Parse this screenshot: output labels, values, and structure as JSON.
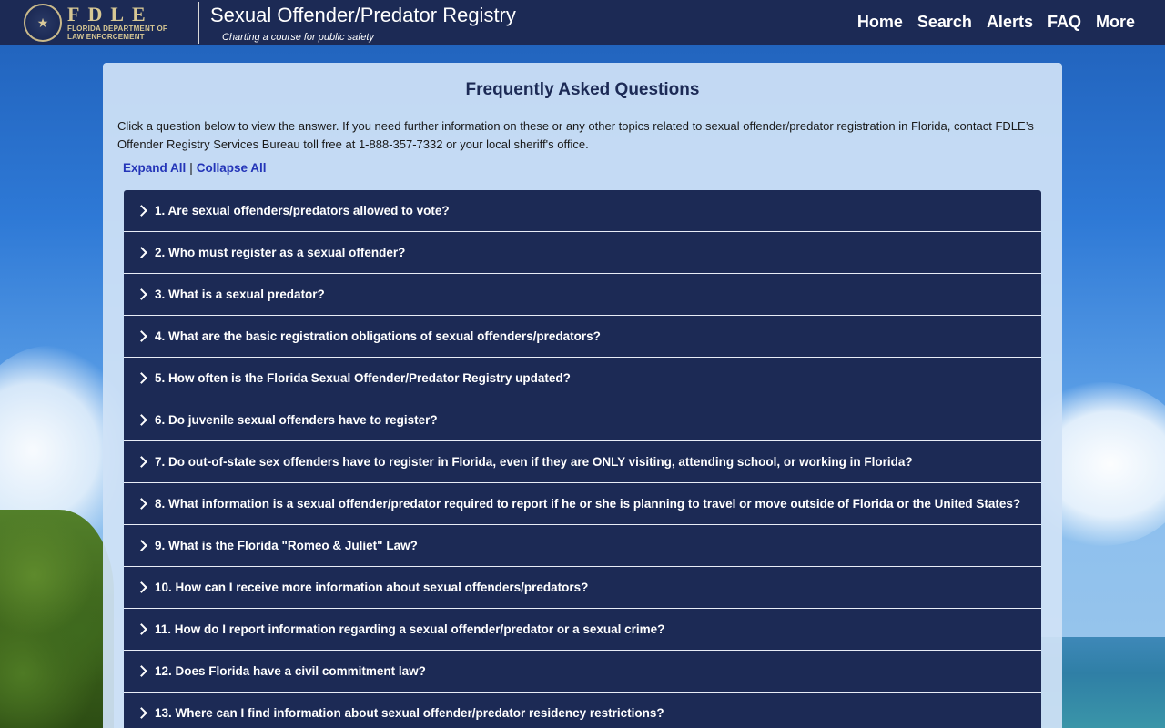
{
  "header": {
    "logo": {
      "wordmark": "FDLE",
      "subtitle_line1": "FLORIDA DEPARTMENT OF",
      "subtitle_line2": "LAW ENFORCEMENT",
      "seal_icon": "state-seal-icon"
    },
    "title": "Sexual Offender/Predator Registry",
    "tagline": "Charting a course for public safety",
    "nav": [
      "Home",
      "Search",
      "Alerts",
      "FAQ",
      "More"
    ]
  },
  "colors": {
    "header_bg": "#1c2a55",
    "accordion_bg": "#1c2a55",
    "link": "#2435b8",
    "logo_gold": "#d8c894"
  },
  "main": {
    "title": "Frequently Asked Questions",
    "intro": "Click a question below to view the answer. If you need further information on these or any other topics related to sexual offender/predator registration in Florida, contact FDLE’s Offender Registry Services Bureau toll free at 1-888-357-7332 or your local sheriff's office.",
    "expand_all": "Expand All",
    "separator": "|",
    "collapse_all": "Collapse All",
    "faqs": [
      "1. Are sexual offenders/predators allowed to vote?",
      "2. Who must register as a sexual offender?",
      "3. What is a sexual predator?",
      "4. What are the basic registration obligations of sexual offenders/predators?",
      "5. How often is the Florida Sexual Offender/Predator Registry updated?",
      "6. Do juvenile sexual offenders have to register?",
      "7. Do out-of-state sex offenders have to register in Florida, even if they are ONLY visiting, attending school, or working in Florida?",
      "8. What information is a sexual offender/predator required to report if he or she is planning to travel or move outside of Florida or the United States?",
      "9. What is the Florida \"Romeo & Juliet\" Law?",
      "10. How can I receive more information about sexual offenders/predators?",
      "11. How do I report information regarding a sexual offender/predator or a sexual crime?",
      "12. Does Florida have a civil commitment law?",
      "13. Where can I find information about sexual offender/predator residency restrictions?"
    ]
  }
}
